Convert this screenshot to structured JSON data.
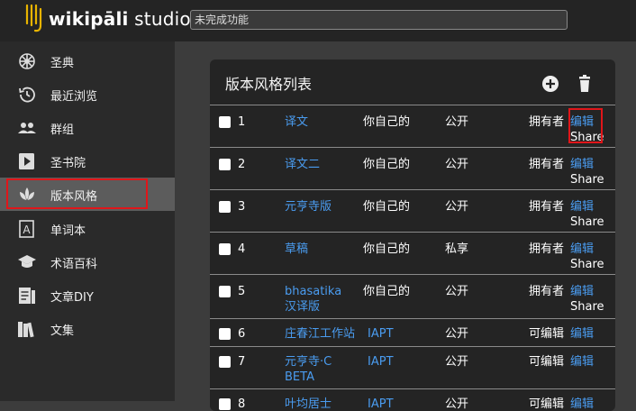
{
  "app": {
    "logo_bold": "wikipāli",
    "logo_rest": " studio",
    "search_placeholder": "未完成功能"
  },
  "sidebar": {
    "items": [
      {
        "label": "圣典",
        "icon": "dharma-wheel-icon"
      },
      {
        "label": "最近浏览",
        "icon": "history-clock-icon"
      },
      {
        "label": "群组",
        "icon": "group-people-icon"
      },
      {
        "label": "圣书院",
        "icon": "play-video-icon"
      },
      {
        "label": "版本风格",
        "icon": "lotus-icon",
        "active": true
      },
      {
        "label": "单词本",
        "icon": "dictionary-a-icon"
      },
      {
        "label": "术语百科",
        "icon": "graduation-cap-icon"
      },
      {
        "label": "文章DIY",
        "icon": "article-icon"
      },
      {
        "label": "文集",
        "icon": "books-icon"
      }
    ]
  },
  "card": {
    "title": "版本风格列表",
    "add_icon": "add-circle-icon",
    "delete_icon": "trash-icon"
  },
  "rows": [
    {
      "num": "1",
      "name": "译文",
      "owner": "你自己的",
      "privacy": "公开",
      "role": "拥有者",
      "edit": "编辑",
      "share": "Share"
    },
    {
      "num": "2",
      "name": "译文二",
      "owner": "你自己的",
      "privacy": "公开",
      "role": "拥有者",
      "edit": "编辑",
      "share": "Share"
    },
    {
      "num": "3",
      "name": "元亨寺版",
      "owner": "你自己的",
      "privacy": "公开",
      "role": "拥有者",
      "edit": "编辑",
      "share": "Share"
    },
    {
      "num": "4",
      "name": "草稿",
      "owner": "你自己的",
      "privacy": "私享",
      "role": "拥有者",
      "edit": "编辑",
      "share": "Share"
    },
    {
      "num": "5",
      "name": "bhasatika汉译版",
      "owner": "你自己的",
      "privacy": "公开",
      "role": "拥有者",
      "edit": "编辑",
      "share": "Share"
    },
    {
      "num": "6",
      "name": "庄春江工作站",
      "owner": "IAPT",
      "privacy": "公开",
      "role": "可编辑",
      "edit": "编辑"
    },
    {
      "num": "7",
      "name": "元亨寺·CBETA",
      "owner": "IAPT",
      "privacy": "公开",
      "role": "可编辑",
      "edit": "编辑"
    },
    {
      "num": "8",
      "name": "叶均居士",
      "owner": "IAPT",
      "privacy": "公开",
      "role": "可编辑",
      "edit": "编辑"
    }
  ],
  "colors": {
    "link": "#4a9cf0",
    "highlight": "#e0161a",
    "sidebar_active": "#5c5c5c"
  }
}
